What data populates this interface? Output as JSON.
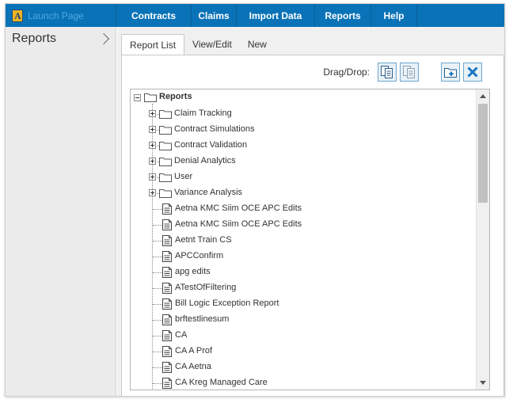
{
  "nav": {
    "launch_label": "Launch Page",
    "items": [
      "Contracts",
      "Claims",
      "Import Data",
      "Reports",
      "Help"
    ]
  },
  "sidebar": {
    "title": "Reports"
  },
  "tabs": [
    "Report List",
    "View/Edit",
    "New"
  ],
  "toolbar": {
    "drag_drop_label": "Drag/Drop:"
  },
  "tree": {
    "root": "Reports",
    "folders": [
      "Claim Tracking",
      "Contract Simulations",
      "Contract Validation",
      "Denial Analytics",
      "User",
      "Variance Analysis"
    ],
    "reports": [
      "Aetna KMC Siim OCE APC Edits",
      "Aetna KMC Siim OCE APC Edits",
      "Aetnt Train CS",
      "APCConfirm",
      "apg edits",
      "ATestOfFiltering",
      "Bill Logic Exception Report",
      "brftestlinesum",
      "CA",
      "CA A Prof",
      "CA Aetna",
      "CA Kreg Managed Care"
    ]
  },
  "colors": {
    "nav_bg": "#0a73b8",
    "accent": "#1a73c0",
    "sidebar_bg": "#ebebeb"
  }
}
